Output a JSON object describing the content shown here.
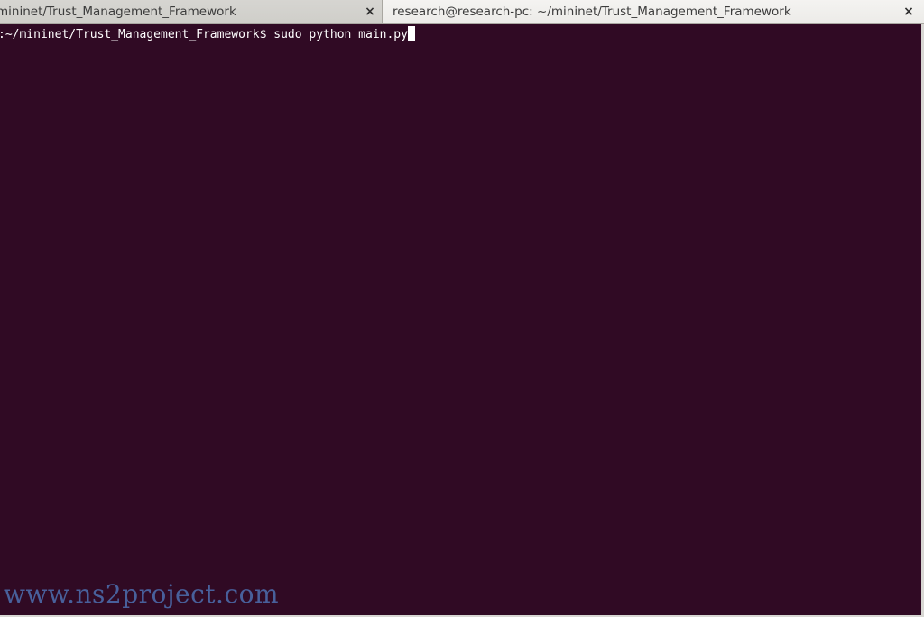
{
  "tabs": [
    {
      "title": "mininet/Trust_Management_Framework",
      "active": false,
      "close_glyph": "×"
    },
    {
      "title": "research@research-pc: ~/mininet/Trust_Management_Framework",
      "active": true,
      "close_glyph": "×"
    }
  ],
  "terminal": {
    "prompt": ":~/mininet/Trust_Management_Framework$ ",
    "command": "sudo python main.py",
    "background": "#300a24",
    "foreground": "#ffffff"
  },
  "watermark": {
    "text": "www.ns2project.com",
    "color": "#4b6aa8"
  },
  "icons": {
    "tab_close": "close-icon",
    "cursor": "text-cursor"
  }
}
